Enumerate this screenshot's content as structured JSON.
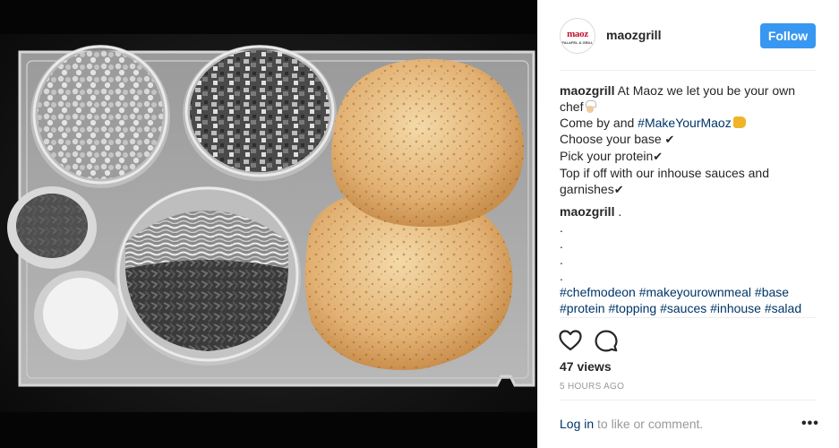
{
  "post": {
    "username": "maozgrill",
    "avatar_logo": "maoz",
    "avatar_sub": "FALAFEL & GRILL",
    "follow_label": "Follow"
  },
  "caption": {
    "author": "maozgrill",
    "line1_text": "At Maoz we let you be your own",
    "line2_text": "chef",
    "line3_pre": "Come by and",
    "line3_tag": "#MakeYourMaoz",
    "line4_text": "Choose your base",
    "line5_text": "Pick your protein",
    "line6_text": "Top if off with our inhouse sauces and",
    "line7_text": "garnishes",
    "check_mark": "✔"
  },
  "reply": {
    "author": "maozgrill",
    "dot": ".",
    "dots": [
      ".",
      ".",
      ".",
      "."
    ],
    "tag_line1": [
      "#chefmodeon",
      "#makeyourownmeal",
      "#base"
    ],
    "tag_line2": [
      "#protein",
      "#topping",
      "#sauces",
      "#inhouse",
      "#salad"
    ]
  },
  "stats": {
    "views": "47 views",
    "time": "5 HOURS AGO"
  },
  "footer": {
    "login_link": "Log in",
    "login_rest": " to like or comment.",
    "more": "•••"
  },
  "icons": {
    "like": "heart-icon",
    "comment": "comment-icon",
    "more": "more-options-icon"
  },
  "colors": {
    "follow_bg": "#3897f0",
    "link": "#003569",
    "text": "#262626",
    "muted": "#999999"
  }
}
